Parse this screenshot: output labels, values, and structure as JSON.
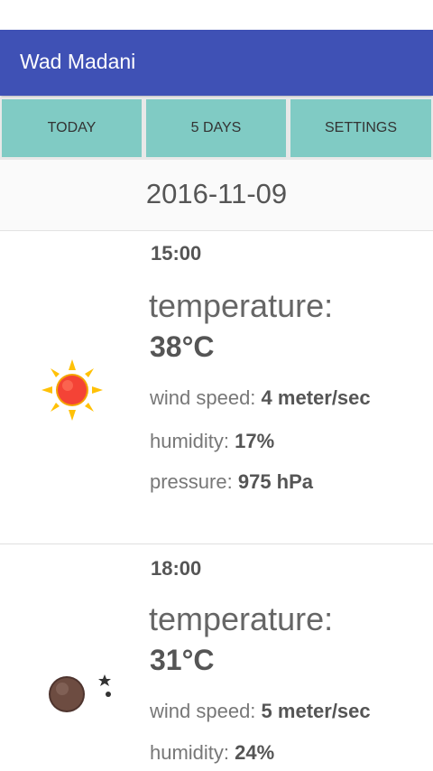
{
  "app": {
    "title": "Wad Madani"
  },
  "tabs": [
    {
      "label": "TODAY"
    },
    {
      "label": "5 DAYS"
    },
    {
      "label": "SETTINGS"
    }
  ],
  "date": "2016-11-09",
  "forecasts": [
    {
      "time": "15:00",
      "icon": "sun-icon",
      "temperature_label": "temperature:",
      "temperature_value": "38°C",
      "wind_label": "wind speed:",
      "wind_value": "4 meter/sec",
      "humidity_label": "humidity:",
      "humidity_value": "17%",
      "pressure_label": "pressure:",
      "pressure_value": "975 hPa"
    },
    {
      "time": "18:00",
      "icon": "moon-icon",
      "temperature_label": "temperature:",
      "temperature_value": "31°C",
      "wind_label": "wind speed:",
      "wind_value": "5 meter/sec",
      "humidity_label": "humidity:",
      "humidity_value": "24%"
    }
  ],
  "colors": {
    "app_bar": "#3f51b5",
    "tab_background": "#80cbc4",
    "sun": "#f44336",
    "sun_rays": "#ffc107",
    "moon": "#6d4c41"
  }
}
